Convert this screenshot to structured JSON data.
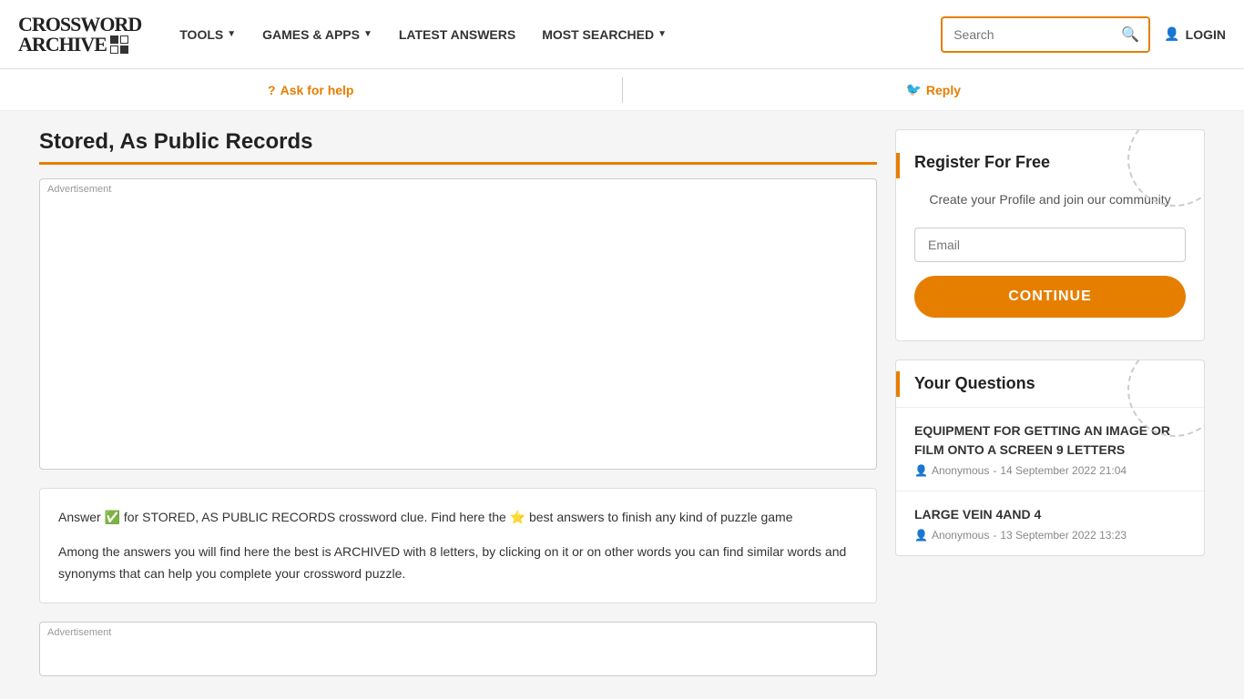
{
  "site": {
    "logo_line1": "CROSSWORD",
    "logo_line2": "ARCHIVE"
  },
  "nav": {
    "tools_label": "TOOLS",
    "tools_arrow": "▼",
    "games_label": "GAMES & APPS",
    "games_arrow": "▼",
    "latest_label": "LATEST ANSWERS",
    "most_label": "MOST SEARCHED",
    "most_arrow": "▼"
  },
  "header_right": {
    "search_placeholder": "Search",
    "search_icon": "🔍",
    "login_icon": "👤",
    "login_label": "LOGIN"
  },
  "sub_header": {
    "ask_icon": "?",
    "ask_label": "Ask for help",
    "reply_icon": "🐦",
    "reply_label": "Reply"
  },
  "main": {
    "page_title": "Stored, As Public Records",
    "ad_label": "Advertisement",
    "ad_label_bottom": "Advertisement",
    "answer_para1": "Answer ✅ for STORED, AS PUBLIC RECORDS crossword clue. Find here the ⭐ best answers to finish any kind of puzzle game",
    "answer_para2": "Among the answers you will find here the best is ARCHIVED with 8 letters, by clicking on it or on other words you can find similar words and synonyms that can help you complete your crossword puzzle."
  },
  "register": {
    "title": "Register For Free",
    "description": "Create your Profile and join our community",
    "email_placeholder": "Email",
    "continue_label": "CONTINUE"
  },
  "questions": {
    "title": "Your Questions",
    "items": [
      {
        "question": "EQUIPMENT FOR GETTING AN IMAGE OR FILM ONTO A SCREEN 9 LETTERS",
        "author": "Anonymous",
        "date": "14 September 2022 21:04"
      },
      {
        "question": "LARGE VEIN 4AND 4",
        "author": "Anonymous",
        "date": "13 September 2022 13:23"
      }
    ]
  }
}
